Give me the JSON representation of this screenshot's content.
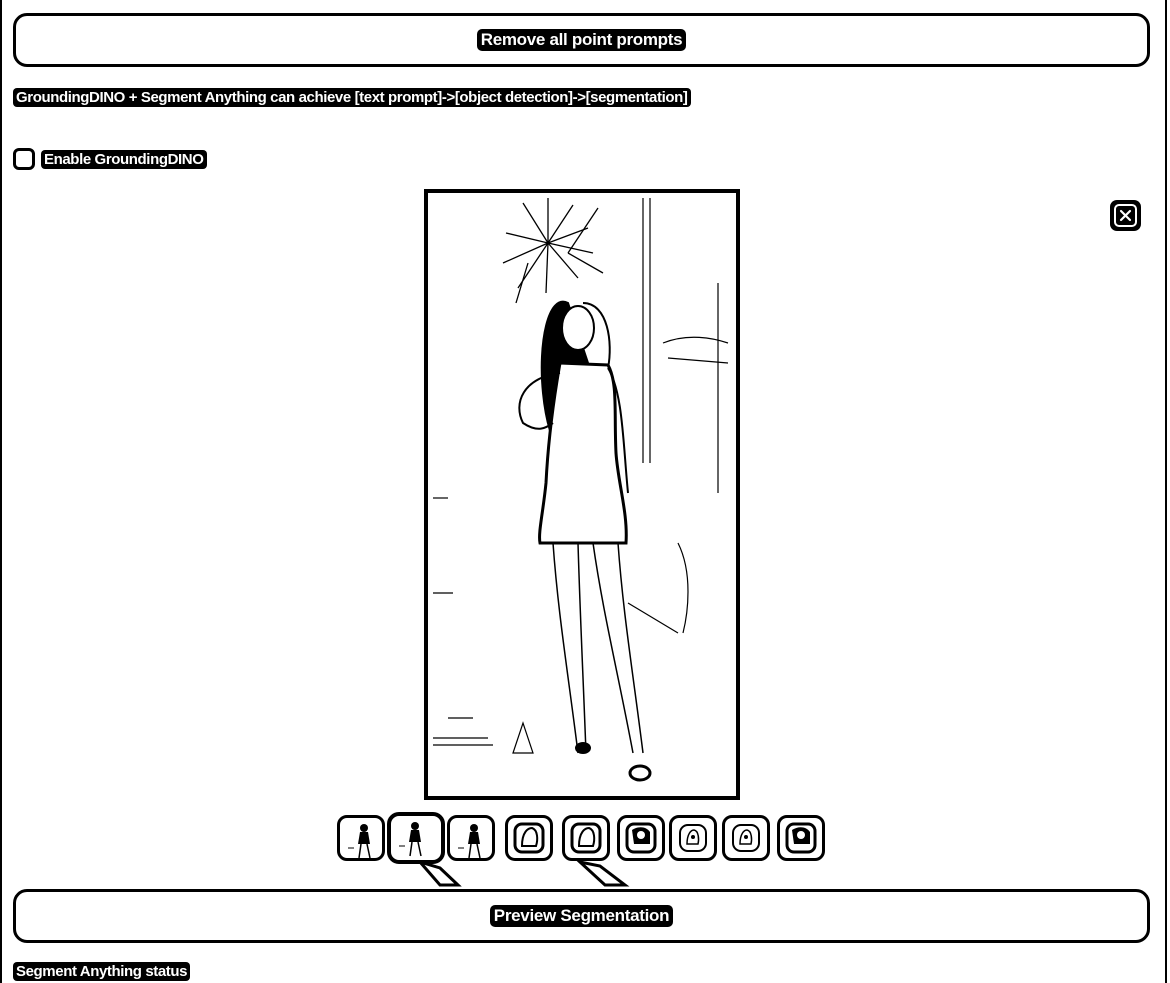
{
  "buttons": {
    "remove_points": "Remove all point prompts",
    "preview": "Preview Segmentation"
  },
  "description": "GroundingDINO + Segment Anything can achieve [text prompt]->[object detection]->[segmentation]",
  "grounding": {
    "checkbox_label": "Enable GroundingDINO",
    "checked": false
  },
  "image_panel": {
    "close_icon": "close-icon",
    "close_glyph": "✕"
  },
  "thumbnails": {
    "count": 9,
    "selected_index": 1,
    "kinds": [
      "person",
      "person",
      "person",
      "mask",
      "mask",
      "mask-cutout",
      "mask-small",
      "mask-small",
      "mask-cutout"
    ]
  },
  "status_label": "Segment Anything status"
}
